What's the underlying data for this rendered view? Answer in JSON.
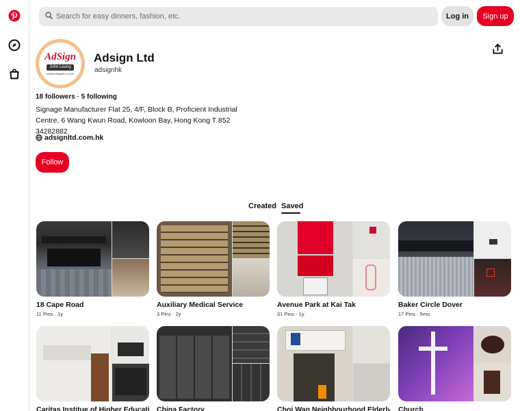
{
  "header": {
    "search_placeholder": "Search for easy dinners, fashion, etc.",
    "login_label": "Log in",
    "signup_label": "Sign up"
  },
  "sidebar": {
    "icons": [
      "pinterest-logo-icon",
      "explore-compass-icon",
      "shop-bag-icon"
    ]
  },
  "profile": {
    "name": "Adsign Ltd",
    "handle": "adsignhk",
    "follow_stats": "18 followers · 5 following",
    "bio": "Signage Manufacturer Flat 25, 4/F, Block B, Proficient Industrial Centre, 6 Wang Kwun Road, Kowloon Bay, Hong Kong T 852 34282882",
    "website": "adsignltd.com.hk",
    "follow_label": "Follow",
    "logo_text": "AdSign",
    "logo_name": "John Leung",
    "logo_web": "info@adsignltd.com.hk"
  },
  "tabs": [
    {
      "label": "Created",
      "active": false
    },
    {
      "label": "Saved",
      "active": true
    }
  ],
  "boards": [
    {
      "title": "18 Cape Road",
      "meta": "11 Pins · 1y"
    },
    {
      "title": "Auxiliary Medical Service",
      "meta": "3 Pins · 2y"
    },
    {
      "title": "Avenue Park at Kai Tak",
      "meta": "31 Pins · 1y"
    },
    {
      "title": "Baker Circle Dover",
      "meta": "17 Pins · 5mo"
    },
    {
      "title": "Caritas Institue of Higher Education",
      "meta": ""
    },
    {
      "title": "China Factory",
      "meta": ""
    },
    {
      "title": "Choi Wan Neighbourhood Elderly",
      "meta": ""
    },
    {
      "title": "Church",
      "meta": ""
    }
  ],
  "colors": {
    "brand_red": "#e60023",
    "search_bg": "#e9e9e9",
    "login_bg": "#e2e2e2"
  }
}
